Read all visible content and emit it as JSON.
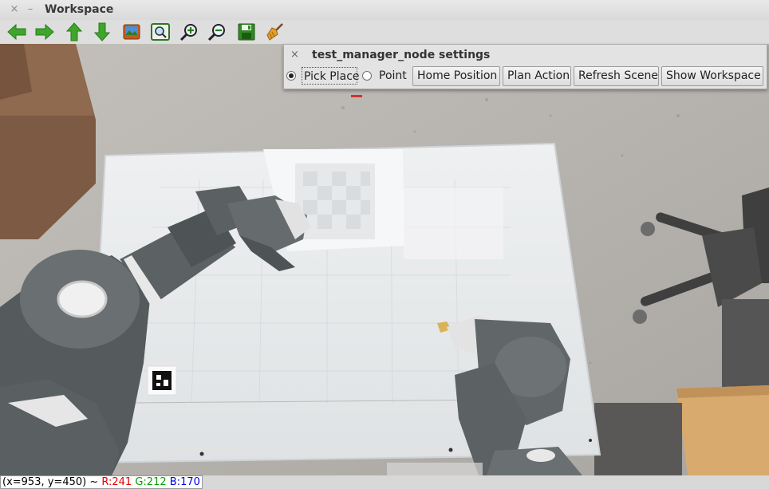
{
  "window": {
    "title": "Workspace",
    "close_glyph": "×",
    "minimize_glyph": "–"
  },
  "toolbar": {
    "tools": [
      "arrow-left-icon",
      "arrow-right-icon",
      "arrow-up-icon",
      "arrow-down-icon",
      "image-icon",
      "zoom-fit-icon",
      "zoom-in-icon",
      "zoom-out-icon",
      "save-icon",
      "broom-icon"
    ]
  },
  "dialog": {
    "title": "test_manager_node settings",
    "close_glyph": "×",
    "mode_options": [
      "Pick Place",
      "Point"
    ],
    "selected_mode": "Pick Place",
    "buttons": [
      "Home Position",
      "Plan Action",
      "Refresh Scene",
      "Show Workspace"
    ]
  },
  "status": {
    "coords": "(x=953, y=450) ~ ",
    "r": "R:241",
    "g": "G:212",
    "b": "B:170"
  },
  "colors": {
    "r": "#e00000",
    "g": "#00a000",
    "b": "#0000e0",
    "toolbar_green": "#3fa62a"
  }
}
